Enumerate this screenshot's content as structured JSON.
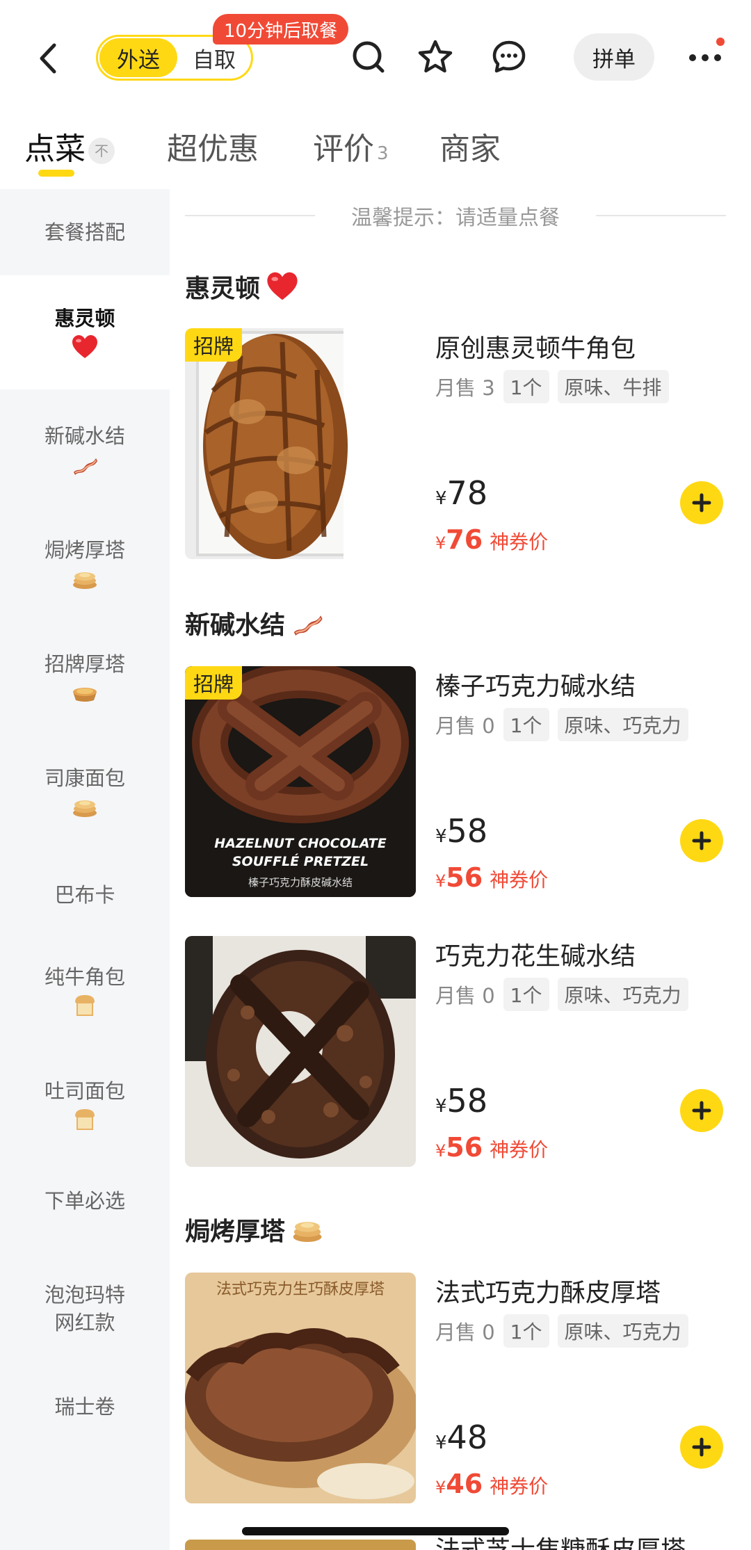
{
  "header": {
    "mode_delivery": "外送",
    "mode_pickup": "自取",
    "pickup_tip": "10分钟后取餐",
    "group_order": "拼单"
  },
  "tabs": [
    {
      "label": "点菜",
      "badge": "不"
    },
    {
      "label": "超优惠"
    },
    {
      "label": "评价",
      "count": "3"
    },
    {
      "label": "商家"
    }
  ],
  "sidebar": {
    "items": [
      {
        "label": "套餐搭配"
      },
      {
        "label": "惠灵顿",
        "emoji": "red-heart"
      },
      {
        "label": "新碱水结",
        "emoji": "bacon"
      },
      {
        "label": "焗烤厚塔",
        "emoji": "pancakes"
      },
      {
        "label": "招牌厚塔",
        "emoji": "pie"
      },
      {
        "label": "司康面包",
        "emoji": "pancakes"
      },
      {
        "label": "巴布卡"
      },
      {
        "label": "纯牛角包",
        "emoji": "bread"
      },
      {
        "label": "吐司面包",
        "emoji": "bread"
      },
      {
        "label": "下单必选"
      },
      {
        "label": "泡泡玛特",
        "label2": "网红款"
      },
      {
        "label": "瑞士卷"
      }
    ]
  },
  "notice": "温馨提示：请适量点餐",
  "categories": [
    {
      "title": "惠灵顿",
      "emoji": "red-heart"
    },
    {
      "title": "新碱水结",
      "emoji": "bacon"
    },
    {
      "title": "焗烤厚塔",
      "emoji": "pancakes"
    }
  ],
  "products": [
    {
      "name": "原创惠灵顿牛角包",
      "tag": "招牌",
      "monthly": "月售 3",
      "qty": "1个",
      "spec": "原味、牛排",
      "currency": "¥",
      "price": "78",
      "coupon_price": "76",
      "coupon_label": "神券价"
    },
    {
      "name": "榛子巧克力碱水结",
      "tag": "招牌",
      "monthly": "月售 0",
      "qty": "1个",
      "spec": "原味、巧克力",
      "currency": "¥",
      "price": "58",
      "coupon_price": "56",
      "coupon_label": "神券价",
      "image_text1": "HAZELNUT CHOCOLATE",
      "image_text2": "SOUFFLÉ PRETZEL",
      "image_text3": "榛子巧克力酥皮碱水结"
    },
    {
      "name": "巧克力花生碱水结",
      "monthly": "月售 0",
      "qty": "1个",
      "spec": "原味、巧克力",
      "currency": "¥",
      "price": "58",
      "coupon_price": "56",
      "coupon_label": "神券价"
    },
    {
      "name": "法式巧克力酥皮厚塔",
      "monthly": "月售 0",
      "qty": "1个",
      "spec": "原味、巧克力",
      "currency": "¥",
      "price": "48",
      "coupon_price": "46",
      "coupon_label": "神券价",
      "image_text1": "法式巧克力生巧酥皮厚塔"
    }
  ],
  "next_product_name": "法式芝士焦糖酥皮厚塔",
  "colors": {
    "brand_yellow": "#FFD814",
    "price_red": "#F04A36",
    "sidebar_bg": "#F5F6F8"
  }
}
